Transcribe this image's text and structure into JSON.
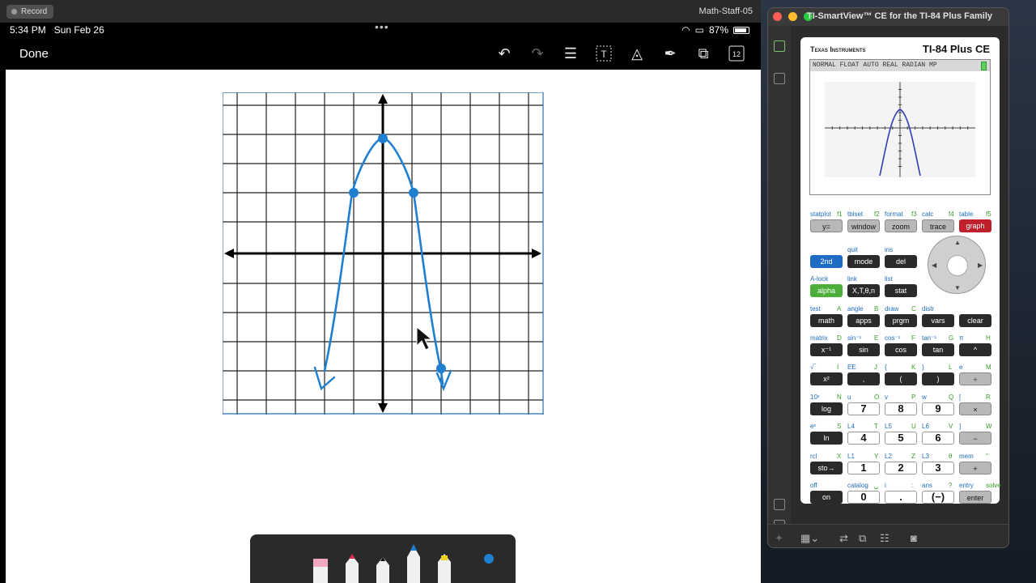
{
  "recorder": {
    "record_label": "Record",
    "title": "Math-Staff-05"
  },
  "ipad_status": {
    "time": "5:34 PM",
    "date": "Sun Feb 26",
    "dots": "•••",
    "battery": "87%"
  },
  "toolbar": {
    "done_label": "Done",
    "page_number": "12"
  },
  "window": {
    "title": "TI-SmartView™ CE for the TI-84 Plus Family"
  },
  "calculator": {
    "brand": "Texas Instruments",
    "model": "TI-84 Plus CE",
    "status_line": "NORMAL FLOAT AUTO REAL RADIAN MP",
    "func_labels": [
      {
        "top": "statplot",
        "alt": "f1",
        "key": "y="
      },
      {
        "top": "tblset",
        "alt": "f2",
        "key": "window"
      },
      {
        "top": "format",
        "alt": "f3",
        "key": "zoom"
      },
      {
        "top": "calc",
        "alt": "f4",
        "key": "trace"
      },
      {
        "top": "table",
        "alt": "f5",
        "key": "graph"
      }
    ],
    "rows": [
      [
        {
          "key": "2nd",
          "top": "",
          "alt": ""
        },
        {
          "key": "mode",
          "top": "quit",
          "alt": ""
        },
        {
          "key": "del",
          "top": "ins",
          "alt": ""
        }
      ],
      [
        {
          "key": "alpha",
          "top": "A-lock",
          "alt": ""
        },
        {
          "key": "X,T,θ,n",
          "top": "link",
          "alt": ""
        },
        {
          "key": "stat",
          "top": "list",
          "alt": ""
        }
      ],
      [
        {
          "key": "math",
          "top": "test",
          "alt": "A"
        },
        {
          "key": "apps",
          "top": "angle",
          "alt": "B"
        },
        {
          "key": "prgm",
          "top": "draw",
          "alt": "C"
        },
        {
          "key": "vars",
          "top": "distr",
          "alt": ""
        },
        {
          "key": "clear",
          "top": "",
          "alt": ""
        }
      ],
      [
        {
          "key": "x⁻¹",
          "top": "matrix",
          "alt": "D"
        },
        {
          "key": "sin",
          "top": "sin⁻¹",
          "alt": "E"
        },
        {
          "key": "cos",
          "top": "cos⁻¹",
          "alt": "F"
        },
        {
          "key": "tan",
          "top": "tan⁻¹",
          "alt": "G"
        },
        {
          "key": "^",
          "top": "π",
          "alt": "H"
        }
      ],
      [
        {
          "key": "x²",
          "top": "√‾",
          "alt": "I"
        },
        {
          "key": ",",
          "top": "EE",
          "alt": "J"
        },
        {
          "key": "(",
          "top": "{",
          "alt": "K"
        },
        {
          "key": ")",
          "top": "}",
          "alt": "L"
        },
        {
          "key": "÷",
          "top": "e",
          "alt": "M"
        }
      ],
      [
        {
          "key": "log",
          "top": "10ˣ",
          "alt": "N"
        },
        {
          "key": "7",
          "top": "u",
          "alt": "O"
        },
        {
          "key": "8",
          "top": "v",
          "alt": "P"
        },
        {
          "key": "9",
          "top": "w",
          "alt": "Q"
        },
        {
          "key": "×",
          "top": "[",
          "alt": "R"
        }
      ],
      [
        {
          "key": "ln",
          "top": "eˣ",
          "alt": "S"
        },
        {
          "key": "4",
          "top": "L4",
          "alt": "T"
        },
        {
          "key": "5",
          "top": "L5",
          "alt": "U"
        },
        {
          "key": "6",
          "top": "L6",
          "alt": "V"
        },
        {
          "key": "−",
          "top": "]",
          "alt": "W"
        }
      ],
      [
        {
          "key": "sto→",
          "top": "rcl",
          "alt": "X"
        },
        {
          "key": "1",
          "top": "L1",
          "alt": "Y"
        },
        {
          "key": "2",
          "top": "L2",
          "alt": "Z"
        },
        {
          "key": "3",
          "top": "L3",
          "alt": "θ"
        },
        {
          "key": "+",
          "top": "mem",
          "alt": "\""
        }
      ],
      [
        {
          "key": "on",
          "top": "off",
          "alt": ""
        },
        {
          "key": "0",
          "top": "catalog",
          "alt": "␣"
        },
        {
          "key": ".",
          "top": "i",
          "alt": ":"
        },
        {
          "key": "(−)",
          "top": "ans",
          "alt": "?"
        },
        {
          "key": "enter",
          "top": "entry",
          "alt": "solve"
        }
      ]
    ]
  },
  "colors": {
    "ink": "#1f7fd1",
    "graph_key": "#c0202c",
    "second_key": "#1f6cc4",
    "alpha_key": "#4caf3a"
  }
}
